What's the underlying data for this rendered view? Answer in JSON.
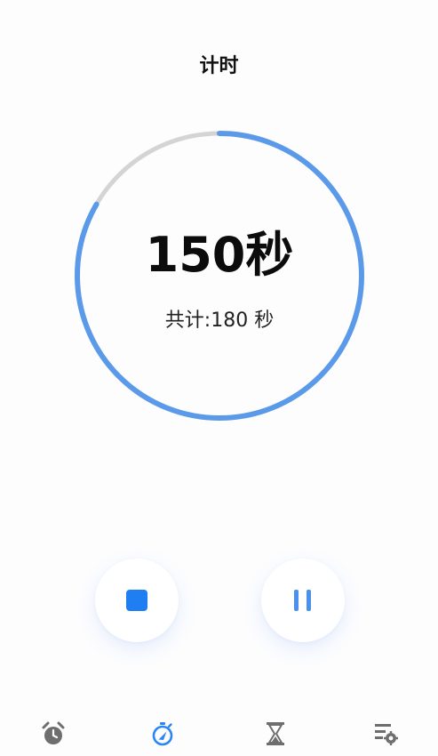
{
  "header": {
    "title": "计时"
  },
  "timer": {
    "remaining_display": "150秒",
    "total_label": "共计:180 秒",
    "remaining_seconds": 150,
    "total_seconds": 180
  },
  "colors": {
    "accent": "#5a9ae8",
    "track": "#d4d4d4",
    "stop": "#1f7ef2",
    "nav_active": "#2a86f2",
    "nav_inactive": "#6e6e6e"
  },
  "controls": {
    "stop_icon": "stop-icon",
    "pause_icon": "pause-icon"
  },
  "nav": {
    "items": [
      {
        "icon": "alarm-clock-icon",
        "active": false
      },
      {
        "icon": "stopwatch-icon",
        "active": true
      },
      {
        "icon": "hourglass-icon",
        "active": false
      },
      {
        "icon": "settings-list-icon",
        "active": false
      }
    ]
  }
}
